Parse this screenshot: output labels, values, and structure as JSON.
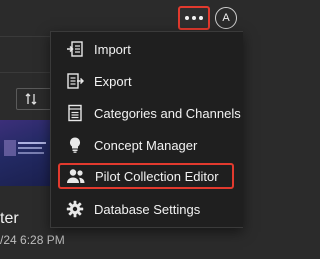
{
  "header": {
    "more_icon": "more-horizontal-icon",
    "avatar_initial": "A"
  },
  "background": {
    "sort_icon": "sort-icon",
    "card_title_fragment": "ter",
    "card_date_fragment": "/24 6:28 PM"
  },
  "menu": {
    "items": [
      {
        "label": "Import",
        "icon": "import-icon"
      },
      {
        "label": "Export",
        "icon": "export-icon"
      },
      {
        "label": "Categories and Channels",
        "icon": "categories-icon"
      },
      {
        "label": "Concept Manager",
        "icon": "lightbulb-icon"
      },
      {
        "label": "Pilot Collection Editor",
        "icon": "users-icon",
        "highlighted": true
      },
      {
        "label": "Database Settings",
        "icon": "gear-icon"
      }
    ]
  },
  "colors": {
    "highlight": "#e23a2e",
    "menu_bg": "#1f1f1f",
    "page_bg": "#2b2b2b"
  }
}
